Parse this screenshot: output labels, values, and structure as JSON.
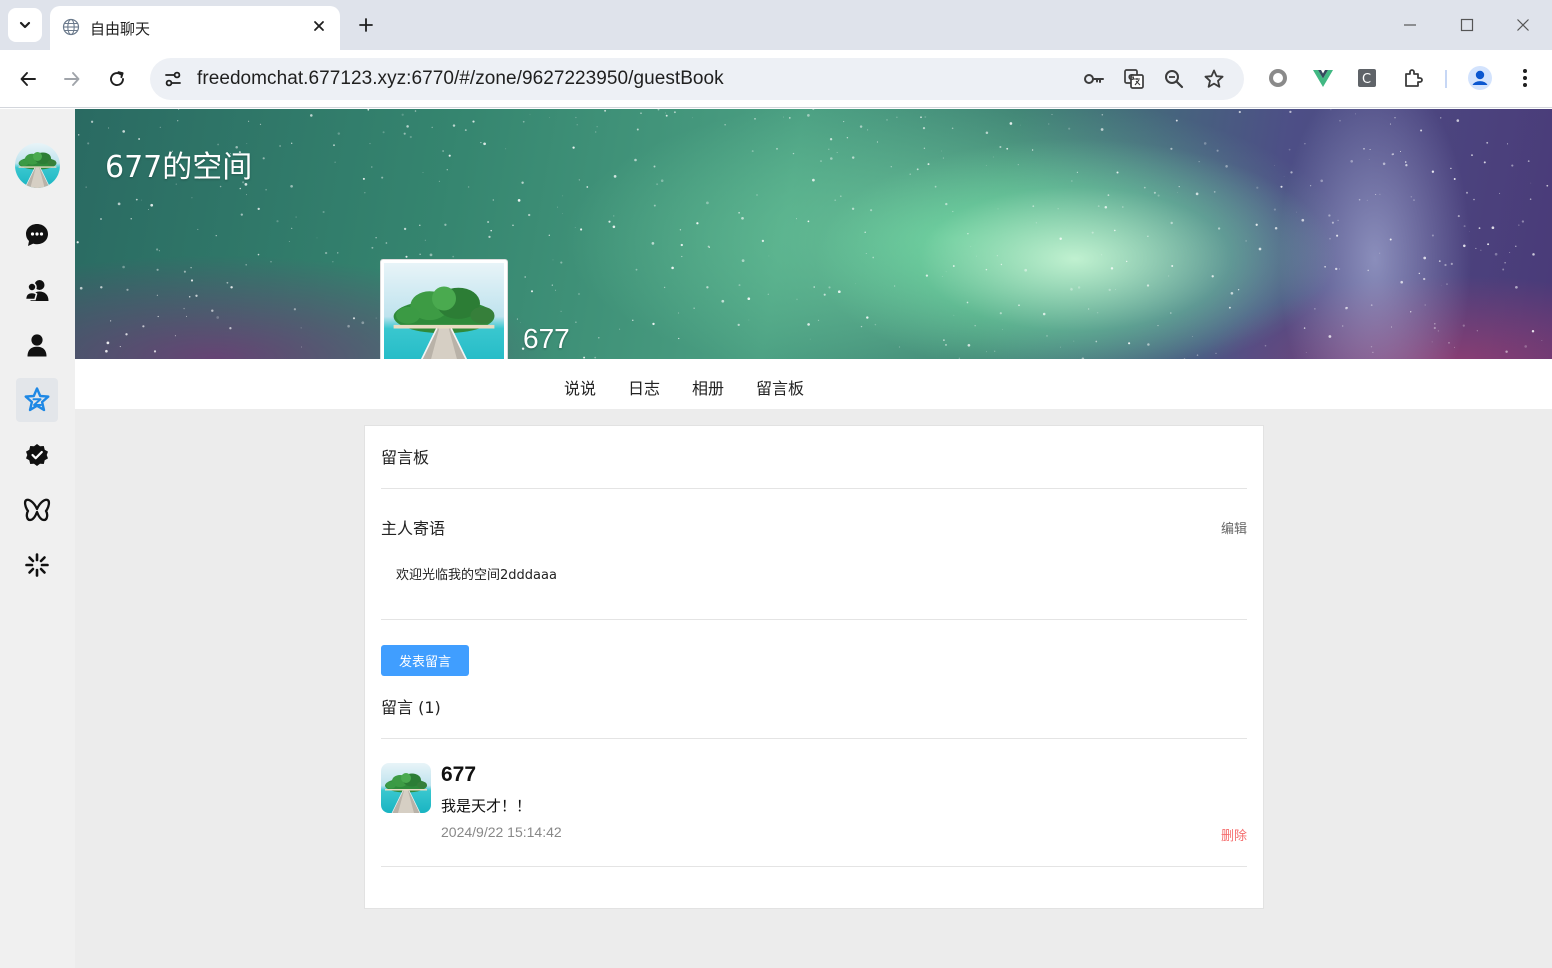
{
  "browser": {
    "tab_title": "自由聊天",
    "url": "freedomchat.677123.xyz:6770/#/zone/9627223950/guestBook"
  },
  "sidebar": {
    "items": [
      {
        "icon": "chat-bubble-icon"
      },
      {
        "icon": "contacts-icon"
      },
      {
        "icon": "person-icon"
      },
      {
        "icon": "star-zone-icon",
        "active": true
      },
      {
        "icon": "verified-badge-icon"
      },
      {
        "icon": "butterfly-icon"
      },
      {
        "icon": "sparkle-icon"
      }
    ]
  },
  "zone": {
    "title": "677的空间",
    "owner_name": "677",
    "nav": [
      "说说",
      "日志",
      "相册",
      "留言板"
    ]
  },
  "guestbook": {
    "title": "留言板",
    "owner_words_title": "主人寄语",
    "edit_label": "编辑",
    "owner_words": "欢迎光临我的空间2dddaaa",
    "post_button": "发表留言",
    "messages_label": "留言 (1)",
    "messages": [
      {
        "author": "677",
        "text": "我是天才！！",
        "time": "2024/9/22 15:14:42",
        "delete_label": "删除"
      }
    ]
  },
  "colors": {
    "primary": "#409eff",
    "danger": "#f56c6c",
    "sidebar_bg": "#f0f0f0",
    "content_bg": "#ececec",
    "active_icon": "#1e88e5"
  }
}
